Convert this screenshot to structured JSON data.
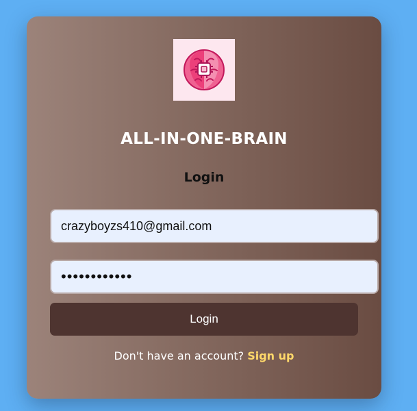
{
  "app": {
    "name": "ALL-IN-ONE-BRAIN",
    "logo_icon": "brain-chip-icon"
  },
  "form": {
    "title": "Login",
    "email_value": "crazyboyzs410@gmail.com",
    "password_value": "••••••••••••",
    "submit_label": "Login"
  },
  "footer": {
    "prompt": "Don't have an account?",
    "signup_label": "Sign up"
  },
  "colors": {
    "page_background": "#5eaff3",
    "card_gradient_start": "#9c837a",
    "card_gradient_end": "#6a4c42",
    "button_background": "#4e3430",
    "link_accent": "#ffd86a",
    "input_background": "#e8f0fe"
  }
}
